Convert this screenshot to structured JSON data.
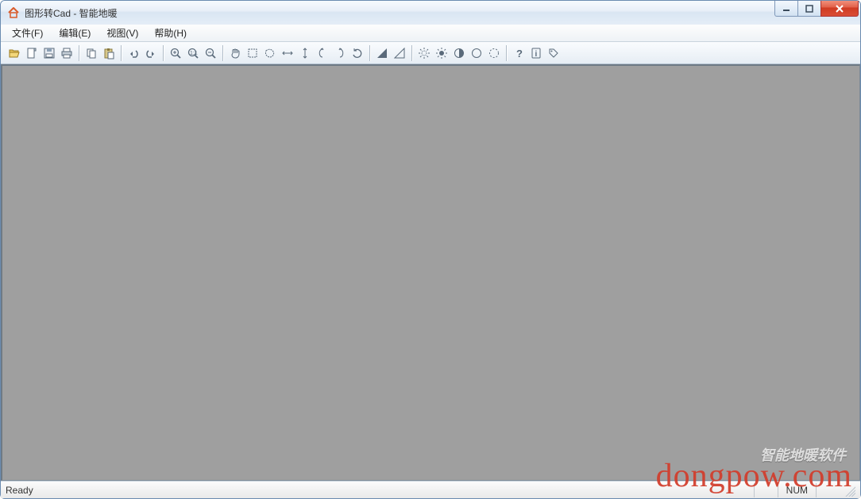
{
  "title": "图形转Cad - 智能地暖",
  "menus": {
    "file": "文件(F)",
    "edit": "编辑(E)",
    "view": "视图(V)",
    "help": "帮助(H)"
  },
  "toolbar_icons": {
    "open": "open-icon",
    "new": "new-icon",
    "save": "save-icon",
    "print": "print-icon",
    "copy": "copy-icon",
    "paste": "paste-icon",
    "undo": "undo-icon",
    "redo": "redo-icon",
    "zoom_in": "zoom-in-icon",
    "zoom_fit": "zoom-fit-icon",
    "zoom_out": "zoom-out-icon",
    "pan": "pan-icon",
    "select_window": "select-window-icon",
    "select_free": "select-free-icon",
    "arrow_h": "arrow-horizontal-icon",
    "arrow_v": "arrow-vertical-icon",
    "arrow_left": "arrow-left-icon",
    "arrow_right": "arrow-right-icon",
    "rotate": "rotate-icon",
    "shade_dark": "shade-dark-icon",
    "shade_light": "shade-light-icon",
    "brightness": "brightness-icon",
    "sun": "sun-icon",
    "contrast": "contrast-icon",
    "circle": "circle-icon",
    "circle_dashed": "circle-dashed-icon",
    "help": "help-icon",
    "info": "info-icon",
    "tag": "tag-icon"
  },
  "status": {
    "left": "Ready",
    "ins": "",
    "num": "NUM",
    "grip": ""
  },
  "watermark": {
    "main": "dongpow.com",
    "sub": "智能地暖软件"
  }
}
